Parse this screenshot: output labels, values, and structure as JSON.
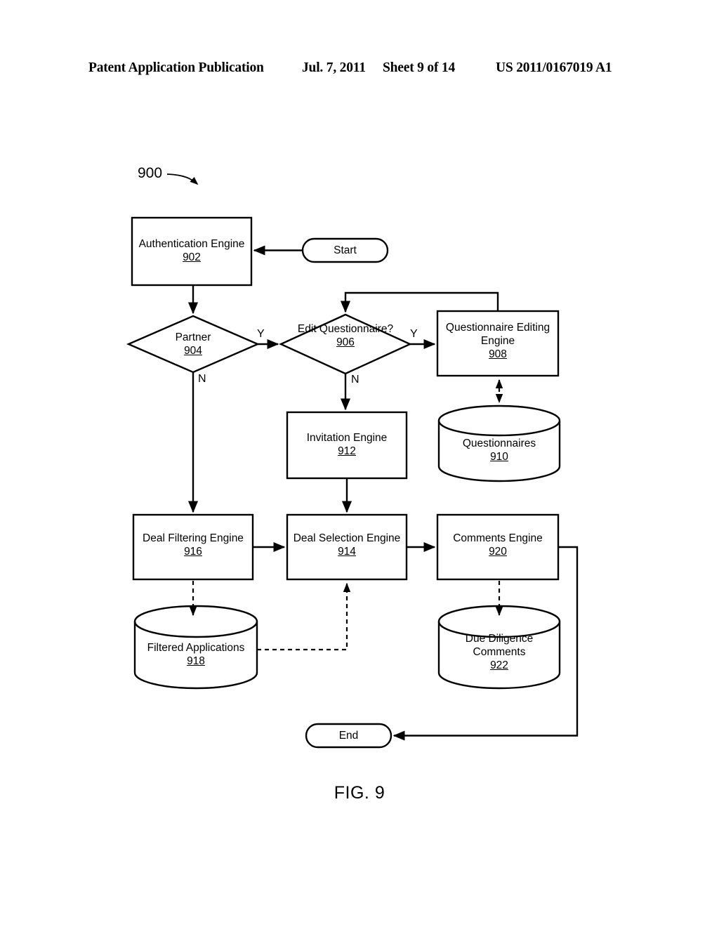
{
  "header": {
    "publication": "Patent Application Publication",
    "date": "Jul. 7, 2011",
    "sheet": "Sheet 9 of 14",
    "number": "US 2011/0167019 A1"
  },
  "figure": {
    "caption": "FIG. 9",
    "diagram_ref": "900"
  },
  "nodes": {
    "start": {
      "label": "Start"
    },
    "end": {
      "label": "End"
    },
    "auth_engine": {
      "label": "Authentication Engine",
      "ref": "902"
    },
    "partner": {
      "label": "Partner",
      "ref": "904"
    },
    "edit_questionnaire": {
      "label": "Edit Questionnaire?",
      "ref": "906"
    },
    "questionnaire_editing_engine": {
      "label": "Questionnaire Editing Engine",
      "ref": "908"
    },
    "questionnaires_db": {
      "label": "Questionnaires",
      "ref": "910"
    },
    "invitation_engine": {
      "label": "Invitation Engine",
      "ref": "912"
    },
    "deal_selection_engine": {
      "label": "Deal Selection Engine",
      "ref": "914"
    },
    "deal_filtering_engine": {
      "label": "Deal Filtering Engine",
      "ref": "916"
    },
    "filtered_applications_db": {
      "label": "Filtered Applications",
      "ref": "918"
    },
    "comments_engine": {
      "label": "Comments Engine",
      "ref": "920"
    },
    "due_diligence_comments_db": {
      "label": "Due Diligence Comments",
      "ref": "922"
    }
  },
  "branches": {
    "partner_yes": "Y",
    "partner_no": "N",
    "edit_yes": "Y",
    "edit_no": "N"
  },
  "colors": {
    "stroke": "#000000",
    "background": "#ffffff"
  }
}
